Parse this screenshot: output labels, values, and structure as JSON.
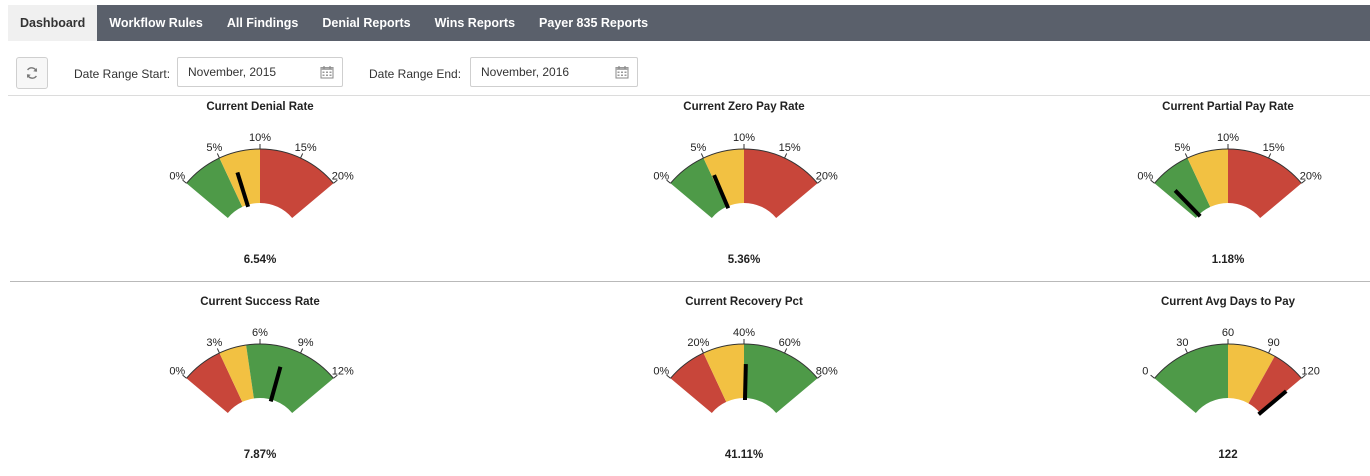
{
  "nav": {
    "tabs": [
      {
        "label": "Dashboard",
        "active": true
      },
      {
        "label": "Workflow Rules",
        "active": false
      },
      {
        "label": "All Findings",
        "active": false
      },
      {
        "label": "Denial Reports",
        "active": false
      },
      {
        "label": "Wins Reports",
        "active": false
      },
      {
        "label": "Payer 835 Reports",
        "active": false
      }
    ]
  },
  "filters": {
    "refresh_icon": "refresh-icon",
    "start_label": "Date Range Start:",
    "start_value": "November, 2015",
    "end_label": "Date Range End:",
    "end_value": "November, 2016",
    "calendar_icon": "calendar-icon"
  },
  "colors": {
    "green": "#4e9a48",
    "yellow": "#f2c142",
    "red": "#c8463a",
    "needle": "#000000",
    "nav_bg": "#5a606b"
  },
  "gauges": [
    {
      "title": "Current Denial Rate",
      "display": "6.54%",
      "value": 6.54,
      "min": 0,
      "max": 20,
      "ticks": [
        0,
        5,
        10,
        15,
        20
      ],
      "tick_labels": [
        "0%",
        "5%",
        "10%",
        "15%",
        "20%"
      ],
      "bands": [
        {
          "from": 0,
          "to": 5,
          "color": "green"
        },
        {
          "from": 5,
          "to": 10,
          "color": "yellow"
        },
        {
          "from": 10,
          "to": 20,
          "color": "red"
        }
      ]
    },
    {
      "title": "Current Zero Pay Rate",
      "display": "5.36%",
      "value": 5.36,
      "min": 0,
      "max": 20,
      "ticks": [
        0,
        5,
        10,
        15,
        20
      ],
      "tick_labels": [
        "0%",
        "5%",
        "10%",
        "15%",
        "20%"
      ],
      "bands": [
        {
          "from": 0,
          "to": 5,
          "color": "green"
        },
        {
          "from": 5,
          "to": 10,
          "color": "yellow"
        },
        {
          "from": 10,
          "to": 20,
          "color": "red"
        }
      ]
    },
    {
      "title": "Current Partial Pay Rate",
      "display": "1.18%",
      "value": 1.18,
      "min": 0,
      "max": 20,
      "ticks": [
        0,
        5,
        10,
        15,
        20
      ],
      "tick_labels": [
        "0%",
        "5%",
        "10%",
        "15%",
        "20%"
      ],
      "bands": [
        {
          "from": 0,
          "to": 5,
          "color": "green"
        },
        {
          "from": 5,
          "to": 10,
          "color": "yellow"
        },
        {
          "from": 10,
          "to": 20,
          "color": "red"
        }
      ]
    },
    {
      "title": "Current Success Rate",
      "display": "7.87%",
      "value": 7.87,
      "min": 0,
      "max": 12,
      "ticks": [
        0,
        3,
        6,
        9,
        12
      ],
      "tick_labels": [
        "0%",
        "3%",
        "6%",
        "9%",
        "12%"
      ],
      "bands": [
        {
          "from": 0,
          "to": 3,
          "color": "red"
        },
        {
          "from": 3,
          "to": 5,
          "color": "yellow"
        },
        {
          "from": 5,
          "to": 12,
          "color": "green"
        }
      ]
    },
    {
      "title": "Current Recovery Pct",
      "display": "41.11%",
      "value": 41.11,
      "min": 0,
      "max": 80,
      "ticks": [
        0,
        20,
        40,
        60,
        80
      ],
      "tick_labels": [
        "0%",
        "20%",
        "40%",
        "60%",
        "80%"
      ],
      "bands": [
        {
          "from": 0,
          "to": 20,
          "color": "red"
        },
        {
          "from": 20,
          "to": 40,
          "color": "yellow"
        },
        {
          "from": 40,
          "to": 80,
          "color": "green"
        }
      ]
    },
    {
      "title": "Current Avg Days to Pay",
      "display": "122",
      "value": 122,
      "min": 0,
      "max": 120,
      "ticks": [
        0,
        30,
        60,
        90,
        120
      ],
      "tick_labels": [
        "0",
        "30",
        "60",
        "90",
        "120"
      ],
      "bands": [
        {
          "from": 0,
          "to": 60,
          "color": "green"
        },
        {
          "from": 60,
          "to": 95,
          "color": "yellow"
        },
        {
          "from": 95,
          "to": 120,
          "color": "red"
        }
      ]
    }
  ]
}
